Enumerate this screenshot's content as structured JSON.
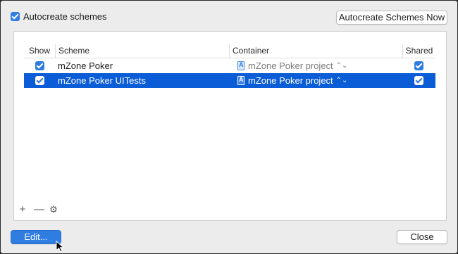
{
  "top": {
    "autocreate_label": "Autocreate schemes",
    "autocreate_now_button": "Autocreate Schemes Now"
  },
  "table": {
    "headers": {
      "show": "Show",
      "scheme": "Scheme",
      "container": "Container",
      "shared": "Shared"
    },
    "rows": [
      {
        "scheme": "mZone Poker",
        "container": "mZone Poker project",
        "show": true,
        "shared": true,
        "selected": false
      },
      {
        "scheme": "mZone Poker UITests",
        "container": "mZone Poker project",
        "show": true,
        "shared": true,
        "selected": true
      }
    ]
  },
  "panel_controls": {
    "add": "+",
    "remove": "—",
    "settings": "⚙"
  },
  "footer": {
    "edit_button": "Edit...",
    "close_button": "Close"
  },
  "colors": {
    "accent": "#2f7de1",
    "selection": "#0a5cd7"
  }
}
